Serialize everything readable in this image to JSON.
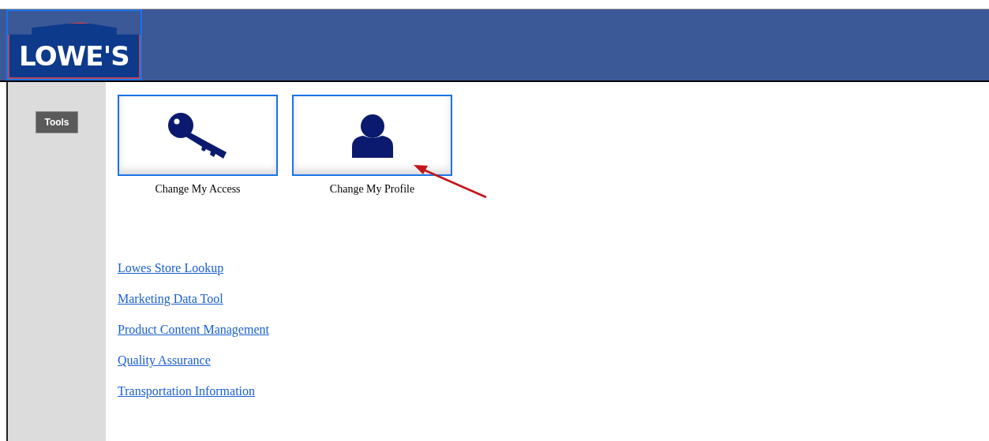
{
  "header": {
    "logo": "LOWE'S"
  },
  "sidebar": {
    "button": "Tools"
  },
  "tiles": [
    {
      "kind": "key",
      "label": "Change My Access"
    },
    {
      "kind": "person",
      "label": "Change My Profile"
    }
  ],
  "links": [
    "Lowes Store Lookup",
    "Marketing Data Tool",
    "Product Content Management",
    "Quality Assurance",
    "Transportation Information"
  ]
}
